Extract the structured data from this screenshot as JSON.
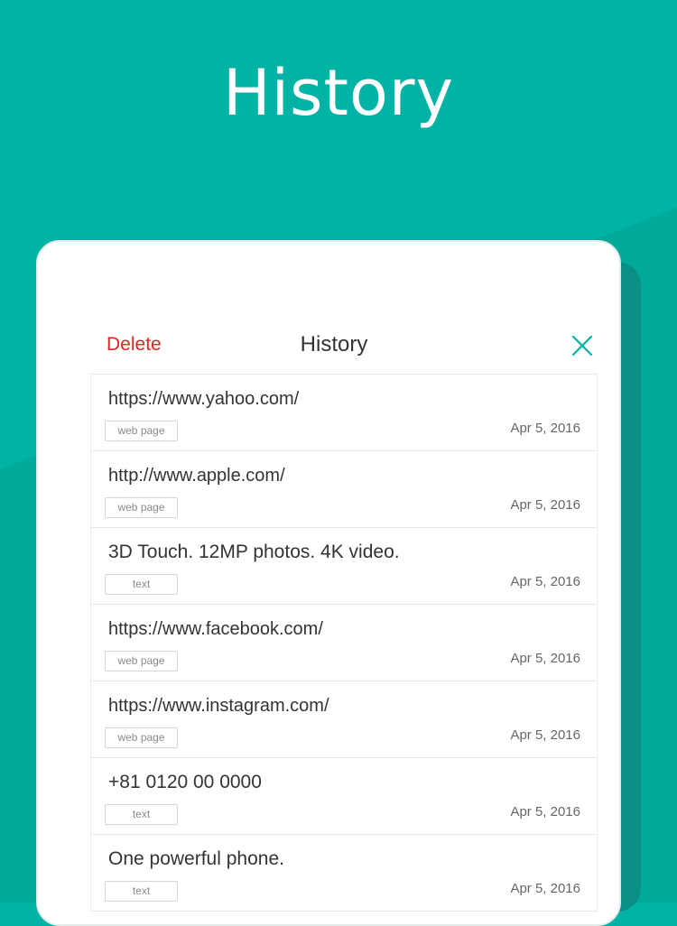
{
  "colors": {
    "background": "#00b3a4",
    "delete": "#e0261c",
    "close": "#00b3a4"
  },
  "promo": {
    "title": "History"
  },
  "header": {
    "delete_label": "Delete",
    "title": "History",
    "close_icon": "close-icon"
  },
  "history": {
    "items": [
      {
        "title": "https://www.yahoo.com/",
        "tag": "web page",
        "date": "Apr 5, 2016"
      },
      {
        "title": "http://www.apple.com/",
        "tag": "web page",
        "date": "Apr 5, 2016"
      },
      {
        "title": "3D Touch. 12MP photos. 4K video.",
        "tag": "text",
        "date": "Apr 5, 2016"
      },
      {
        "title": "https://www.facebook.com/",
        "tag": "web page",
        "date": "Apr 5, 2016"
      },
      {
        "title": "https://www.instagram.com/",
        "tag": "web page",
        "date": "Apr 5, 2016"
      },
      {
        "title": "+81 0120 00 0000",
        "tag": "text",
        "date": "Apr 5, 2016"
      },
      {
        "title": "One powerful phone.",
        "tag": "text",
        "date": "Apr 5, 2016"
      }
    ]
  }
}
